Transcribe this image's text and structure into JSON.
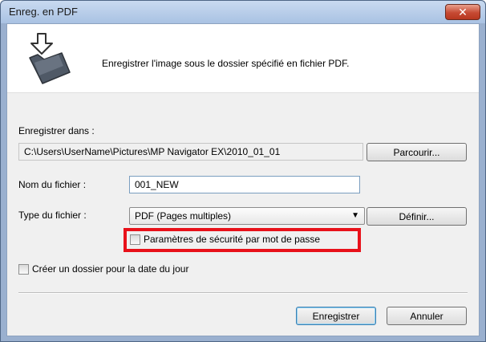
{
  "window": {
    "title": "Enreg. en PDF",
    "close_glyph": "✕"
  },
  "header": {
    "icon": "folder-save-arrow-icon",
    "message": "Enregistrer l'image sous le dossier spécifié en fichier PDF."
  },
  "save_in": {
    "label": "Enregistrer dans :",
    "path": "C:\\Users\\UserName\\Pictures\\MP Navigator EX\\2010_01_01",
    "browse_label": "Parcourir..."
  },
  "file_name": {
    "label": "Nom du fichier :",
    "value": "001_NEW"
  },
  "file_type": {
    "label": "Type du fichier :",
    "selected": "PDF (Pages multiples)",
    "define_label": "Définir..."
  },
  "options": {
    "password_security_label": "Paramètres de sécurité par mot de passe",
    "password_security_checked": false,
    "date_folder_label": "Créer un dossier pour la date du jour",
    "date_folder_checked": false
  },
  "actions": {
    "save_label": "Enregistrer",
    "cancel_label": "Annuler"
  },
  "colors": {
    "highlight": "#e8111a",
    "titlebar": "#b9cfea",
    "close_button": "#c64a33"
  }
}
